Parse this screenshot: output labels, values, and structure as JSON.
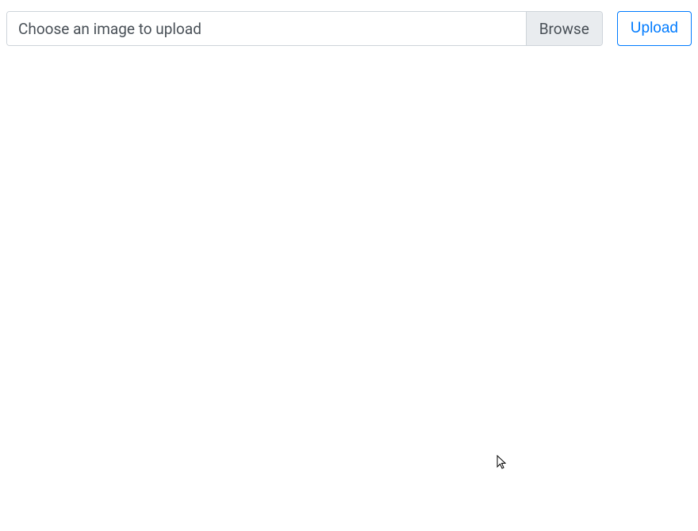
{
  "upload": {
    "placeholder": "Choose an image to upload",
    "browse_label": "Browse",
    "submit_label": "Upload"
  }
}
